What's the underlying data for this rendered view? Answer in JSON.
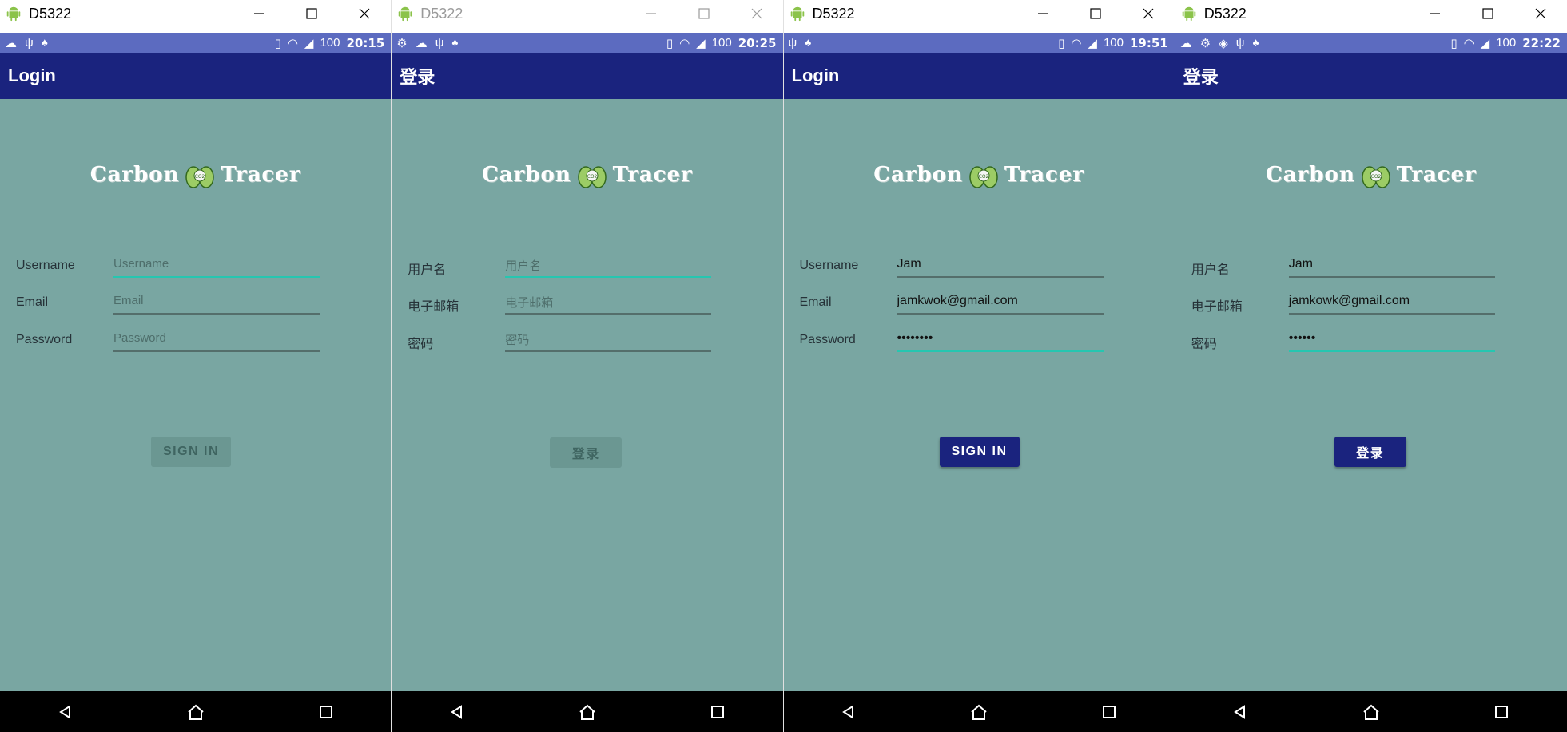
{
  "window_title": "D5322",
  "panels": [
    {
      "time": "20:15",
      "app_title": "Login",
      "logo": {
        "left": "Carbon",
        "right": "Tracer",
        "badge": "CO2"
      },
      "fields": [
        {
          "label": "Username",
          "placeholder": "Username",
          "value": ""
        },
        {
          "label": "Email",
          "placeholder": "Email",
          "value": ""
        },
        {
          "label": "Password",
          "placeholder": "Password",
          "value": ""
        }
      ],
      "button": "SIGN IN",
      "battery": "100"
    },
    {
      "time": "20:25",
      "app_title": "登录",
      "logo": {
        "left": "Carbon",
        "right": "Tracer",
        "badge": "CO2"
      },
      "fields": [
        {
          "label": "用户名",
          "placeholder": "用户名",
          "value": ""
        },
        {
          "label": "电子邮箱",
          "placeholder": "电子邮箱",
          "value": ""
        },
        {
          "label": "密码",
          "placeholder": "密码",
          "value": ""
        }
      ],
      "button": "登录",
      "battery": "100"
    },
    {
      "time": "19:51",
      "app_title": "Login",
      "logo": {
        "left": "Carbon",
        "right": "Tracer",
        "badge": "CO2"
      },
      "fields": [
        {
          "label": "Username",
          "placeholder": "",
          "value": "Jam"
        },
        {
          "label": "Email",
          "placeholder": "",
          "value": "jamkwok@gmail.com"
        },
        {
          "label": "Password",
          "placeholder": "",
          "value": "••••••••"
        }
      ],
      "button": "SIGN IN",
      "battery": "100"
    },
    {
      "time": "22:22",
      "app_title": "登录",
      "logo": {
        "left": "Carbon",
        "right": "Tracer",
        "badge": "CO2"
      },
      "fields": [
        {
          "label": "用户名",
          "placeholder": "",
          "value": "Jam"
        },
        {
          "label": "电子邮箱",
          "placeholder": "",
          "value": "jamkowk@gmail.com"
        },
        {
          "label": "密码",
          "placeholder": "",
          "value": "••••••"
        }
      ],
      "button": "登录",
      "battery": "100"
    }
  ],
  "colors": {
    "app_bar": "#1a237e",
    "status_bar": "#5c6bc0",
    "content_bg": "#79a6a2",
    "focus_underline": "#26c6b0",
    "button_enabled": "#1a237e",
    "button_disabled": "#6b9792"
  }
}
